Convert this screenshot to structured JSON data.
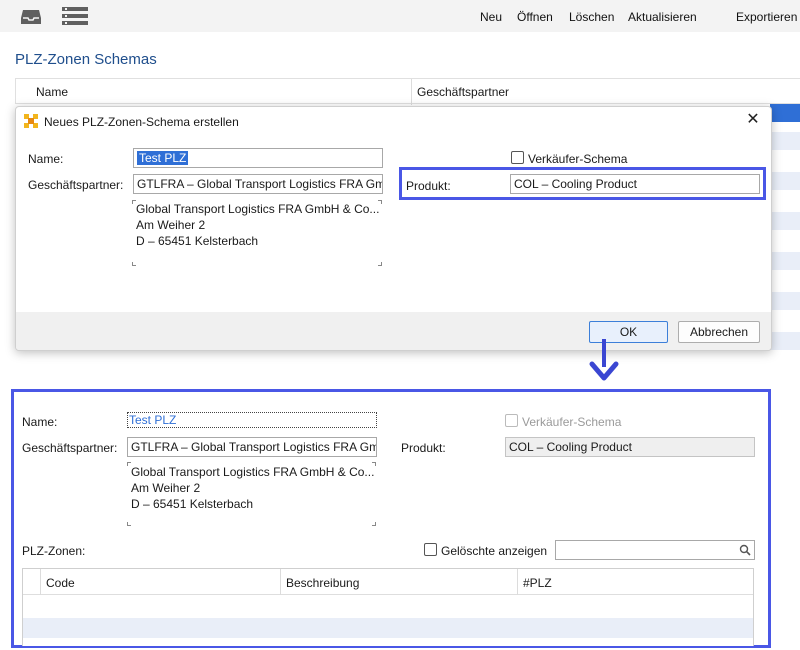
{
  "toolbar": {
    "icons": [
      "inbox-icon",
      "list-icon"
    ],
    "new_label": "Neu",
    "open_label": "Öffnen",
    "delete_label": "Löschen",
    "refresh_label": "Aktualisieren",
    "export_label": "Exportieren"
  },
  "page": {
    "title": "PLZ-Zonen Schemas",
    "table_columns": [
      "Name",
      "Geschäftspartner"
    ]
  },
  "dialog": {
    "title": "Neues PLZ-Zonen-Schema erstellen",
    "name_label": "Name:",
    "name_value": "Test PLZ",
    "partner_label": "Geschäftspartner:",
    "partner_value": "GTLFRA – Global Transport Logistics FRA Gmb",
    "address_lines": [
      "Global Transport Logistics FRA GmbH & Co...",
      "Am Weiher 2",
      "D – 65451 Kelsterbach"
    ],
    "seller_schema_label": "Verkäufer-Schema",
    "seller_schema_checked": false,
    "product_label": "Produkt:",
    "product_value": "COL – Cooling Product",
    "ok_label": "OK",
    "cancel_label": "Abbrechen"
  },
  "detail": {
    "name_label": "Name:",
    "name_value": "Test PLZ",
    "partner_label": "Geschäftspartner:",
    "partner_value": "GTLFRA – Global Transport Logistics FRA Gmb",
    "address_lines": [
      "Global Transport Logistics FRA GmbH & Co...",
      "Am Weiher 2",
      "D – 65451 Kelsterbach"
    ],
    "seller_schema_label": "Verkäufer-Schema",
    "product_label": "Produkt:",
    "product_value": "COL – Cooling Product",
    "zones_label": "PLZ-Zonen:",
    "show_deleted_label": "Gelöschte anzeigen",
    "zone_columns": [
      "Code",
      "Beschreibung",
      "#PLZ"
    ]
  },
  "colors": {
    "highlight": "#4a57e6",
    "title_blue": "#1f4e8c",
    "selection": "#2f6fd6"
  }
}
